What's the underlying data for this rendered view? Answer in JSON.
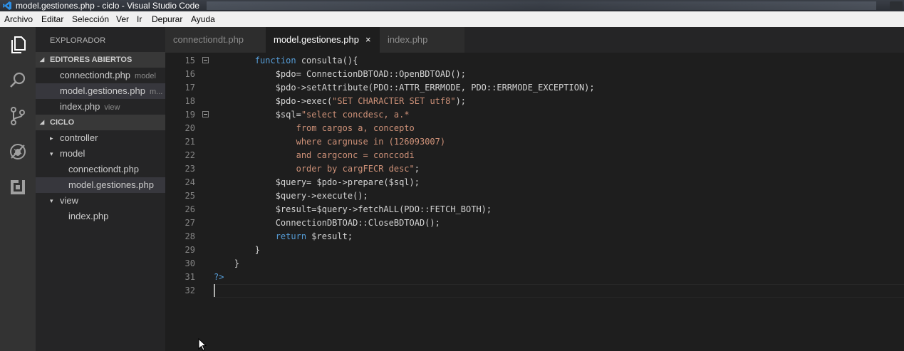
{
  "window": {
    "title": "model.gestiones.php - ciclo - Visual Studio Code"
  },
  "menu": [
    "Archivo",
    "Editar",
    "Selección",
    "Ver",
    "Ir",
    "Depurar",
    "Ayuda"
  ],
  "activity": {
    "items": [
      "files-icon",
      "search-icon",
      "source-control-icon",
      "debug-icon",
      "extensions-icon"
    ]
  },
  "sidebar": {
    "title": "EXPLORADOR",
    "open_editors": {
      "label": "EDITORES ABIERTOS",
      "items": [
        {
          "name": "connectiondt.php",
          "desc": "model"
        },
        {
          "name": "model.gestiones.php",
          "desc": "m..."
        },
        {
          "name": "index.php",
          "desc": "view"
        }
      ]
    },
    "project": {
      "label": "CICLO",
      "items": [
        {
          "name": "controller",
          "twisty": "▸"
        },
        {
          "name": "model",
          "twisty": "▾"
        },
        {
          "name": "connectiondt.php"
        },
        {
          "name": "model.gestiones.php"
        },
        {
          "name": "view",
          "twisty": "▾"
        },
        {
          "name": "index.php"
        }
      ]
    }
  },
  "tabs": [
    {
      "label": "connectiondt.php",
      "active": false
    },
    {
      "label": "model.gestiones.php",
      "active": true,
      "close": "×"
    },
    {
      "label": "index.php",
      "active": false
    }
  ],
  "editor": {
    "lines": [
      {
        "n": "15",
        "fold": true,
        "parts": [
          [
            "        ",
            ""
          ],
          [
            "function",
            "kw"
          ],
          [
            " consulta(){",
            ""
          ]
        ]
      },
      {
        "n": "16",
        "parts": [
          [
            "            $pdo= ConnectionDBTOAD::OpenBDTOAD();",
            ""
          ]
        ]
      },
      {
        "n": "17",
        "parts": [
          [
            "            $pdo->setAttribute(PDO::ATTR_ERRMODE, PDO::ERRMODE_EXCEPTION);",
            ""
          ]
        ]
      },
      {
        "n": "18",
        "parts": [
          [
            "            $pdo->exec(",
            ""
          ],
          [
            "\"SET CHARACTER SET utf8\"",
            "str"
          ],
          [
            ");",
            ""
          ]
        ]
      },
      {
        "n": "19",
        "fold": true,
        "parts": [
          [
            "            $sql=",
            ""
          ],
          [
            "\"select concdesc, a.*",
            "str"
          ]
        ]
      },
      {
        "n": "20",
        "parts": [
          [
            "                from cargos a, concepto",
            "str"
          ]
        ]
      },
      {
        "n": "21",
        "parts": [
          [
            "                where cargnuse in (126093007)",
            "str"
          ]
        ]
      },
      {
        "n": "22",
        "parts": [
          [
            "                and cargconc = conccodi",
            "str"
          ]
        ]
      },
      {
        "n": "23",
        "parts": [
          [
            "                order by cargFECR desc\"",
            "str"
          ],
          [
            ";",
            ""
          ]
        ]
      },
      {
        "n": "24",
        "parts": [
          [
            "            $query= $pdo->prepare($sql);",
            ""
          ]
        ]
      },
      {
        "n": "25",
        "parts": [
          [
            "            $query->execute();",
            ""
          ]
        ]
      },
      {
        "n": "26",
        "parts": [
          [
            "            $result=$query->fetchALL(PDO::FETCH_BOTH);",
            ""
          ]
        ]
      },
      {
        "n": "27",
        "parts": [
          [
            "            ConnectionDBTOAD::CloseBDTOAD();",
            ""
          ]
        ]
      },
      {
        "n": "28",
        "parts": [
          [
            "            ",
            ""
          ],
          [
            "return",
            "kw"
          ],
          [
            " $result;",
            ""
          ]
        ]
      },
      {
        "n": "29",
        "parts": [
          [
            "        }",
            ""
          ]
        ]
      },
      {
        "n": "30",
        "parts": [
          [
            "    }",
            ""
          ]
        ]
      },
      {
        "n": "31",
        "parts": [
          [
            "?>",
            "kw"
          ]
        ]
      },
      {
        "n": "32",
        "parts": [
          [
            "",
            ""
          ]
        ]
      }
    ]
  },
  "colors": {
    "keyword": "#569cd6",
    "string": "#ce9178",
    "text": "#d4d4d4",
    "line_number": "#858585",
    "editor_bg": "#1e1e1e",
    "sidebar_bg": "#252526",
    "activity_bg": "#333333"
  }
}
